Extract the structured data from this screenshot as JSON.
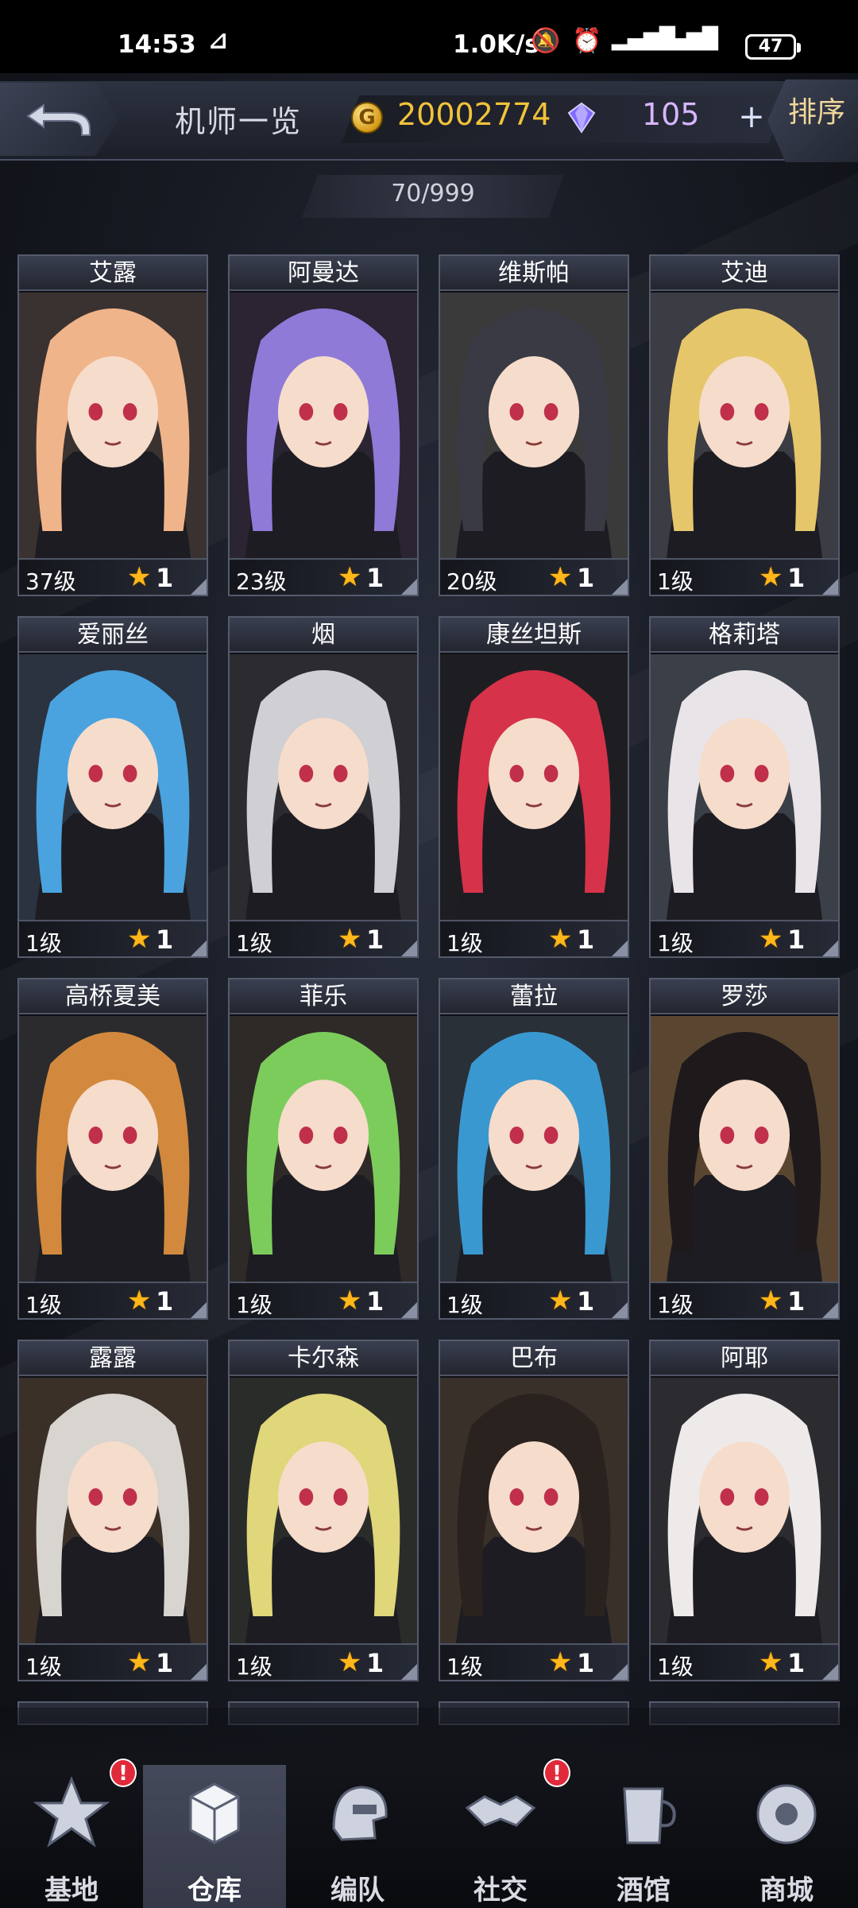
{
  "status_bar": {
    "time": "14:53",
    "speed": "1.0K/s",
    "battery": "47"
  },
  "header": {
    "title": "机师一览",
    "gold": "20002774",
    "gems": "105",
    "plus": "+",
    "sort_label": "排序"
  },
  "count": "70/999",
  "pilots": [
    {
      "name": "艾露",
      "level": "37级",
      "stars": "1",
      "hair": "#f0b48a",
      "bg": "#3a3230"
    },
    {
      "name": "阿曼达",
      "level": "23级",
      "stars": "1",
      "hair": "#8f7ad8",
      "bg": "#2a2433"
    },
    {
      "name": "维斯帕",
      "level": "20级",
      "stars": "1",
      "hair": "#3a3a44",
      "bg": "#3a3a3a"
    },
    {
      "name": "艾迪",
      "level": "1级",
      "stars": "1",
      "hair": "#e6c66a",
      "bg": "#3c3c44"
    },
    {
      "name": "爱丽丝",
      "level": "1级",
      "stars": "1",
      "hair": "#4aa3de",
      "bg": "#2b3340"
    },
    {
      "name": "烟",
      "level": "1级",
      "stars": "1",
      "hair": "#cfcfd4",
      "bg": "#2c2c30"
    },
    {
      "name": "康丝坦斯",
      "level": "1级",
      "stars": "1",
      "hair": "#d6324a",
      "bg": "#1e1e22"
    },
    {
      "name": "格莉塔",
      "level": "1级",
      "stars": "1",
      "hair": "#e8e4e8",
      "bg": "#3a3f48"
    },
    {
      "name": "高桥夏美",
      "level": "1级",
      "stars": "1",
      "hair": "#d2893e",
      "bg": "#2b2b2e"
    },
    {
      "name": "菲乐",
      "level": "1级",
      "stars": "1",
      "hair": "#7ccc5c",
      "bg": "#2e2a28"
    },
    {
      "name": "蕾拉",
      "level": "1级",
      "stars": "1",
      "hair": "#3a98d0",
      "bg": "#2a3038"
    },
    {
      "name": "罗莎",
      "level": "1级",
      "stars": "1",
      "hair": "#1e1a1c",
      "bg": "#5a4630"
    },
    {
      "name": "露露",
      "level": "1级",
      "stars": "1",
      "hair": "#d8d4d0",
      "bg": "#3a3028"
    },
    {
      "name": "卡尔森",
      "level": "1级",
      "stars": "1",
      "hair": "#e0d67a",
      "bg": "#2a2c2a"
    },
    {
      "name": "巴布",
      "level": "1级",
      "stars": "1",
      "hair": "#2a221e",
      "bg": "#3a302a"
    },
    {
      "name": "阿耶",
      "level": "1级",
      "stars": "1",
      "hair": "#eeeaea",
      "bg": "#2c2c30"
    }
  ],
  "nav": [
    {
      "label": "基地",
      "icon": "base-icon",
      "badge": "!"
    },
    {
      "label": "仓库",
      "icon": "warehouse-icon",
      "badge": ""
    },
    {
      "label": "编队",
      "icon": "formation-icon",
      "badge": ""
    },
    {
      "label": "社交",
      "icon": "social-icon",
      "badge": "!"
    },
    {
      "label": "酒馆",
      "icon": "tavern-icon",
      "badge": ""
    },
    {
      "label": "商城",
      "icon": "shop-icon",
      "badge": ""
    }
  ],
  "active_nav": "仓库"
}
